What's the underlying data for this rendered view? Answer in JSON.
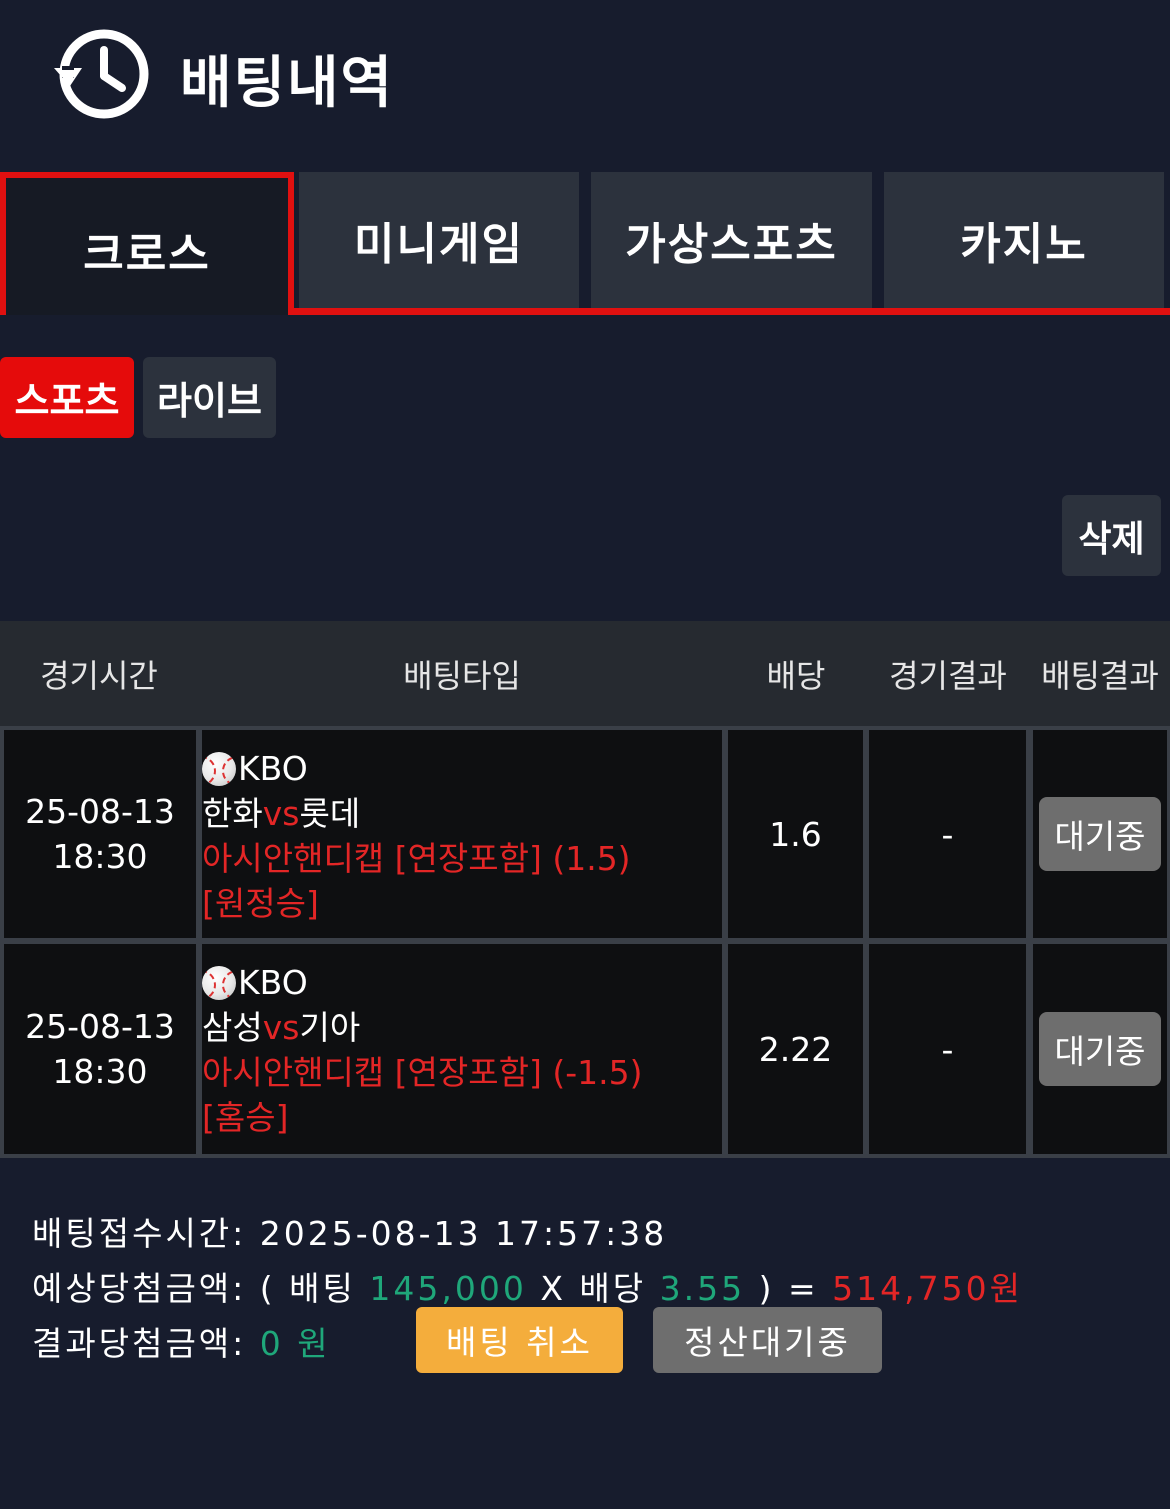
{
  "header": {
    "title": "배팅내역",
    "icon": "history-clock-icon"
  },
  "main_tabs": [
    {
      "label": "크로스",
      "active": true
    },
    {
      "label": "미니게임",
      "active": false
    },
    {
      "label": "가상스포츠",
      "active": false
    },
    {
      "label": "카지노",
      "active": false
    }
  ],
  "sub_tabs": [
    {
      "label": "스포츠",
      "active": true
    },
    {
      "label": "라이브",
      "active": false
    }
  ],
  "delete_label": "삭제",
  "table": {
    "headers": [
      "경기시간",
      "배팅타입",
      "배당",
      "경기결과",
      "배팅결과"
    ],
    "rows": [
      {
        "date": "25-08-13",
        "time": "18:30",
        "league": "KBO",
        "home": "한화",
        "vs": "vs",
        "away": "롯데",
        "bet_type": "아시안핸디캡 [연장포함] (1.5)",
        "pick": "[원정승]",
        "odds": "1.6",
        "game_result": "-",
        "bet_result": "대기중"
      },
      {
        "date": "25-08-13",
        "time": "18:30",
        "league": "KBO",
        "home": "삼성",
        "vs": "vs",
        "away": "기아",
        "bet_type": "아시안핸디캡 [연장포함] (-1.5)",
        "pick": "[홈승]",
        "odds": "2.22",
        "game_result": "-",
        "bet_result": "대기중"
      }
    ]
  },
  "summary": {
    "received_label": "배팅접수시간:",
    "received_time": "2025-08-13 17:57:38",
    "expected_label": "예상당첨금액: ( 배팅",
    "bet_amount": "145,000",
    "x_label": "X 배당",
    "total_odds": "3.55",
    "equals": ") =",
    "expected_amount": "514,750원",
    "result_label": "결과당첨금액:",
    "result_amount": "0 원",
    "cancel_label": "배팅 취소",
    "pending_label": "정산대기중"
  },
  "colors": {
    "background": "#171c2d",
    "accent_red": "#e01010",
    "tab_bg": "#2c323d",
    "green": "#1fa77a",
    "cancel_orange": "#f4ad3c",
    "pending_gray": "#6e6e6e"
  }
}
